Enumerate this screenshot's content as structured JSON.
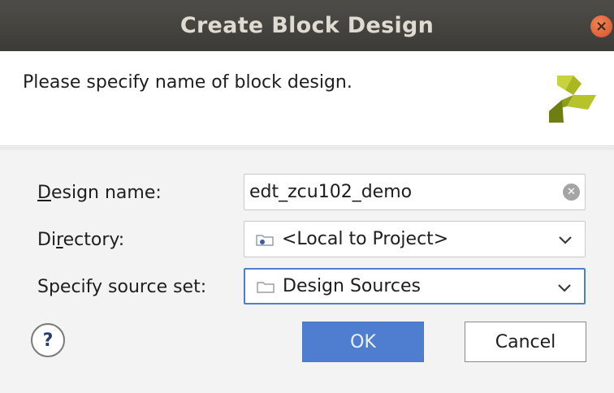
{
  "window": {
    "title": "Create Block Design",
    "close_glyph": "×"
  },
  "header": {
    "prompt": "Please specify name of block design.",
    "logo_icon": "xilinx-vivado-logo-icon"
  },
  "form": {
    "design_name": {
      "label_mnemonic": "D",
      "label_rest": "esign name:",
      "value": "edt_zcu102_demo",
      "clear_glyph": "✕"
    },
    "directory": {
      "label_pre": "Di",
      "label_mnemonic": "r",
      "label_rest": "ectory:",
      "value": "<Local to Project>"
    },
    "source_set": {
      "label": "Specify source set:",
      "value": "Design Sources"
    }
  },
  "footer": {
    "help_glyph": "?",
    "ok_label": "OK",
    "cancel_label": "Cancel"
  },
  "colors": {
    "accent": "#4f7ed0",
    "titlebar": "#3c3b37",
    "close": "#e05a2e"
  }
}
